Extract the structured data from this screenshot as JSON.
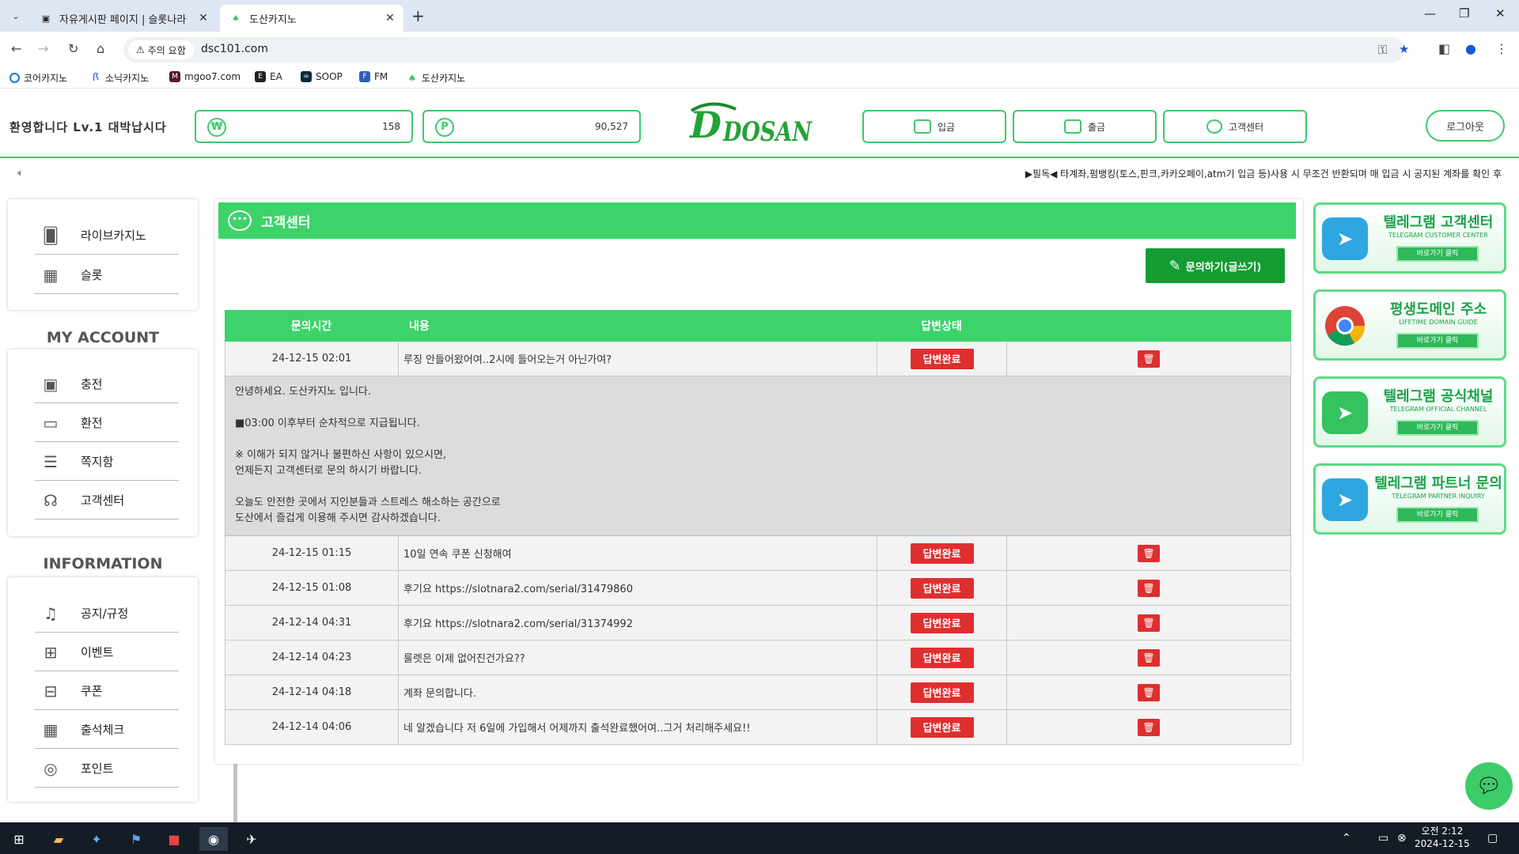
{
  "browser": {
    "tabs": [
      {
        "title": "자유게시판 페이지 | 슬롯나라"
      },
      {
        "title": "도산카지노"
      }
    ],
    "address_warning": "주의 요함",
    "url": "dsc101.com",
    "bookmarks": [
      {
        "label": "코어카지노"
      },
      {
        "label": "소닉카지노"
      },
      {
        "label": "mgoo7.com"
      },
      {
        "label": "EA"
      },
      {
        "label": "SOOP"
      },
      {
        "label": "FM"
      },
      {
        "label": "도산카지노"
      }
    ]
  },
  "header": {
    "welcome": "환영합니다 Lv.1 대박납시다",
    "won_symbol": "₩",
    "balance": "158",
    "point_symbol": "P",
    "points": "90,527",
    "logo_text": "DOSAN",
    "deposit_label": "입금",
    "withdraw_label": "출금",
    "support_label": "고객센터",
    "logout_label": "로그아웃"
  },
  "ticker": {
    "text": "▶필독◀ 타계좌,펌뱅킹(토스,핀크,카카오페이,atm기 입금 등)사용 시 무조건 반환되며 매 입금 시 공지된 계좌를 확인 후"
  },
  "sidebar": {
    "games": [
      {
        "label": "라이브카지노",
        "icon": "cards-icon"
      },
      {
        "label": "슬롯",
        "icon": "slot-machine-icon"
      }
    ],
    "account_title": "MY ACCOUNT",
    "account": [
      {
        "label": "충전",
        "icon": "wallet-icon"
      },
      {
        "label": "환전",
        "icon": "card-icon"
      },
      {
        "label": "쪽지함",
        "icon": "message-icon"
      },
      {
        "label": "고객센터",
        "icon": "headset-icon"
      }
    ],
    "info_title": "INFORMATION",
    "info": [
      {
        "label": "공지/규정",
        "icon": "bell-icon"
      },
      {
        "label": "이벤트",
        "icon": "gift-icon"
      },
      {
        "label": "쿠폰",
        "icon": "ticket-icon"
      },
      {
        "label": "출석체크",
        "icon": "calendar-icon"
      },
      {
        "label": "포인트",
        "icon": "coin-icon"
      }
    ]
  },
  "main": {
    "title": "고객센터",
    "write_button": "문의하기(글쓰기)",
    "columns": {
      "time": "문의시간",
      "content": "내용",
      "status": "답변상태"
    },
    "rows": [
      {
        "time": "24-12-15 02:01",
        "content": "루징 안들어왔어여..2시에 들어오는거 아닌가여?",
        "status": "답변완료"
      },
      {
        "time": "24-12-15 01:15",
        "content": "10일 연속 쿠폰 신청해여",
        "status": "답변완료"
      },
      {
        "time": "24-12-15 01:08",
        "content": "후기요 https://slotnara2.com/serial/31479860",
        "status": "답변완료"
      },
      {
        "time": "24-12-14 04:31",
        "content": "후기요 https://slotnara2.com/serial/31374992",
        "status": "답변완료"
      },
      {
        "time": "24-12-14 04:23",
        "content": "룰렛은 이제 없어진건가요??",
        "status": "답변완료"
      },
      {
        "time": "24-12-14 04:18",
        "content": "계좌 문의합니다.",
        "status": "답변완료"
      },
      {
        "time": "24-12-14 04:06",
        "content": "네 알겠습니다 저 6일에 가입해서 어제까지 출석완료했어여..그거 처리해주세요!!",
        "status": "답변완료"
      }
    ],
    "answer": {
      "line1": "안녕하세요. 도산카지노 입니다.",
      "line2": "■03:00 이후부터 순차적으로 지급됩니다.",
      "line3": "※ 이해가 되지 않거나 불편하신 사항이 있으시면,",
      "line4": "언제든지 고객센터로 문의 하시기 바랍니다.",
      "line5": "오늘도 안전한 곳에서 지인분들과 스트레스 해소하는 공간으로",
      "line6": "도산에서 즐겁게 이용해 주시면 감사하겠습니다."
    }
  },
  "banners": [
    {
      "title": "텔레그램 고객센터",
      "subtitle": "TELEGRAM CUSTOMER CENTER",
      "button": "바로가기 클릭",
      "icon": "telegram-icon",
      "color": "#2ea6e0"
    },
    {
      "title": "평생도메인 주소",
      "subtitle": "LIFETIME DOMAIN GUIDE",
      "button": "바로가기 클릭",
      "icon": "chrome-icon",
      "color": "#db4437"
    },
    {
      "title": "텔레그램 공식채널",
      "subtitle": "TELEGRAM OFFICIAL CHANNEL",
      "button": "바로가기 클릭",
      "icon": "telegram-icon",
      "color": "#35c25f"
    },
    {
      "title": "텔레그램 파트너 문의",
      "subtitle": "TELEGRAM PARTNER INQUIRY",
      "button": "바로가기 클릭",
      "icon": "telegram-icon",
      "color": "#2ea6e0"
    }
  ],
  "taskbar": {
    "time": "오전 2:12",
    "date": "2024-12-15"
  },
  "colors": {
    "accent": "#3dd36b",
    "dark_green": "#149c33",
    "badge_red": "#de2f2f"
  }
}
